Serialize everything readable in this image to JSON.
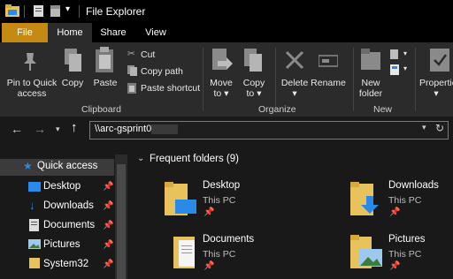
{
  "window": {
    "title": "File Explorer"
  },
  "tabs": {
    "file": "File",
    "home": "Home",
    "share": "Share",
    "view": "View"
  },
  "ribbon": {
    "pin_line1": "Pin to Quick",
    "pin_line2": "access",
    "copy": "Copy",
    "paste": "Paste",
    "cut": "Cut",
    "copy_path": "Copy path",
    "paste_shortcut": "Paste shortcut",
    "move_to": "Move",
    "move_to_2": "to",
    "copy_to": "Copy",
    "copy_to_2": "to",
    "delete": "Delete",
    "rename": "Rename",
    "new_folder": "New",
    "new_folder_2": "folder",
    "properties": "Propertie",
    "groups": {
      "clipboard": "Clipboard",
      "organize": "Organize",
      "new": "New"
    }
  },
  "address": {
    "path": "\\\\arc-gsprint01"
  },
  "nav": {
    "quick_access": "Quick access",
    "items": [
      "Desktop",
      "Downloads",
      "Documents",
      "Pictures",
      "System32"
    ]
  },
  "content": {
    "section_title": "Frequent folders (9)",
    "folders": [
      {
        "name": "Desktop",
        "location": "This PC"
      },
      {
        "name": "Downloads",
        "location": "This PC"
      },
      {
        "name": "Documents",
        "location": "This PC"
      },
      {
        "name": "Pictures",
        "location": "This PC"
      }
    ]
  },
  "colors": {
    "file_tab": "#c48a13",
    "folder": "#e8c25a",
    "accent": "#2a8ae8"
  }
}
